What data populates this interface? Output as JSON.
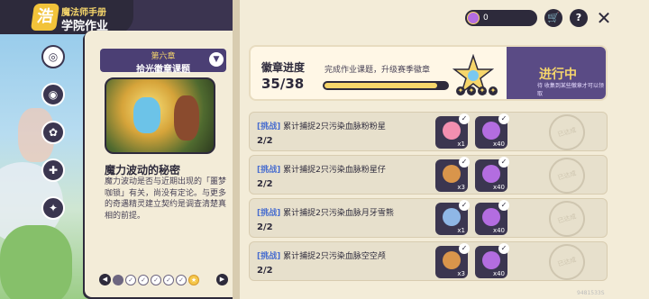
{
  "header": {
    "subtitle": "魔法师手册",
    "title": "学院作业",
    "logo_char": "浩"
  },
  "nav": {
    "icons": [
      {
        "name": "chapter-icon",
        "glyph": "◎",
        "active": true
      },
      {
        "name": "globe-icon",
        "glyph": "◉",
        "active": false
      },
      {
        "name": "flower-icon",
        "glyph": "✿",
        "active": false
      },
      {
        "name": "dumbbell-icon",
        "glyph": "✚",
        "active": false
      },
      {
        "name": "badge-icon",
        "glyph": "✦",
        "active": false
      }
    ]
  },
  "chapter": {
    "number": "第六章",
    "name": "拾光徽章课题",
    "dropdown_glyph": "▼"
  },
  "story": {
    "title": "魔力波动的秘密",
    "text": "魔力波动是否与近期出现的「噩梦咖锁」有关，尚没有定论。与更多的奇遇精灵建立契约是调查清楚真相的前提。"
  },
  "pager": {
    "prev": "◀",
    "next": "▶",
    "dots": [
      "✓",
      "✓",
      "✓",
      "✓",
      "✓",
      "✓",
      "★"
    ]
  },
  "top_bar": {
    "coin_value": "0",
    "shop_glyph": "🛒",
    "help_glyph": "?",
    "close_glyph": "✕"
  },
  "badge_progress": {
    "title": "徽章进度",
    "subtitle": "完成作业课题，升级赛季徽章",
    "count": "35/38",
    "progress": 0.92,
    "stars": [
      "✦",
      "✦",
      "✦",
      "✦"
    ],
    "status": "进行中",
    "status_sub": "待 收集到某些徽章才可以领取"
  },
  "tasks": [
    {
      "tag": "[挑战]",
      "text": "累计捕捉2只污染血脉粉粉星",
      "progress": "2/2",
      "rewards": [
        {
          "color": "#f38fb0",
          "qty": "x1"
        },
        {
          "color": "#b36de0",
          "qty": "x40"
        }
      ],
      "stamp": "已达成"
    },
    {
      "tag": "[挑战]",
      "text": "累计捕捉2只污染血脉粉星仔",
      "progress": "2/2",
      "rewards": [
        {
          "color": "#d9954b",
          "qty": "x3"
        },
        {
          "color": "#b36de0",
          "qty": "x40"
        }
      ],
      "stamp": "已达成"
    },
    {
      "tag": "[挑战]",
      "text": "累计捕捉2只污染血脉月牙雪熊",
      "progress": "2/2",
      "rewards": [
        {
          "color": "#8fb7e6",
          "qty": "x1"
        },
        {
          "color": "#b36de0",
          "qty": "x40"
        }
      ],
      "stamp": "已达成"
    },
    {
      "tag": "[挑战]",
      "text": "累计捕捉2只污染血脉空空颅",
      "progress": "2/2",
      "rewards": [
        {
          "color": "#d9954b",
          "qty": "x3"
        },
        {
          "color": "#b36de0",
          "qty": "x40"
        }
      ],
      "stamp": "已达成"
    }
  ],
  "version": "9481533S"
}
